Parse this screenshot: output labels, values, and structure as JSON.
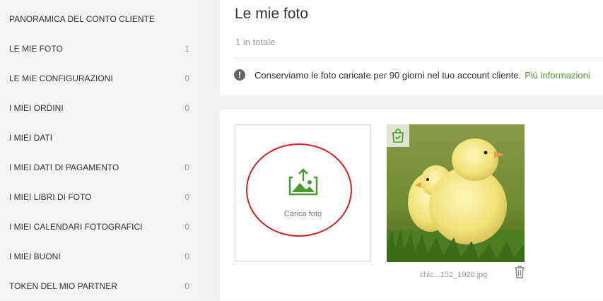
{
  "sidebar": {
    "items": [
      {
        "label": "PANORAMICA DEL CONTO CLIENTE",
        "count": ""
      },
      {
        "label": "LE MIE FOTO",
        "count": "1"
      },
      {
        "label": "LE MIE CONFIGURAZIONI",
        "count": "0"
      },
      {
        "label": "I MIEI ORDINI",
        "count": "0"
      },
      {
        "label": "I MIEI DATI",
        "count": ""
      },
      {
        "label": "I MIEI DATI DI PAGAMENTO",
        "count": "0"
      },
      {
        "label": "I MIEI LIBRI DI FOTO",
        "count": "0"
      },
      {
        "label": "I MIEI CALENDARI FOTOGRAFICI",
        "count": "0"
      },
      {
        "label": "I MIEI BUONI",
        "count": "0"
      },
      {
        "label": "TOKEN DEL MIO PARTNER",
        "count": "0"
      }
    ]
  },
  "main": {
    "title": "Le mie foto",
    "subtitle": "1 in totale",
    "notice_text": "Conserviamo le foto caricate per 90 giorni nel tuo account cliente.",
    "notice_link": "Più informazioni",
    "upload_label": "Carica foto",
    "photo": {
      "filename": "chic...152_1920.jpg",
      "badge_icon": "shopping-bag-check-icon"
    }
  },
  "colors": {
    "accent_green": "#4a9a2e",
    "annotation_red": "#d41f1f"
  }
}
